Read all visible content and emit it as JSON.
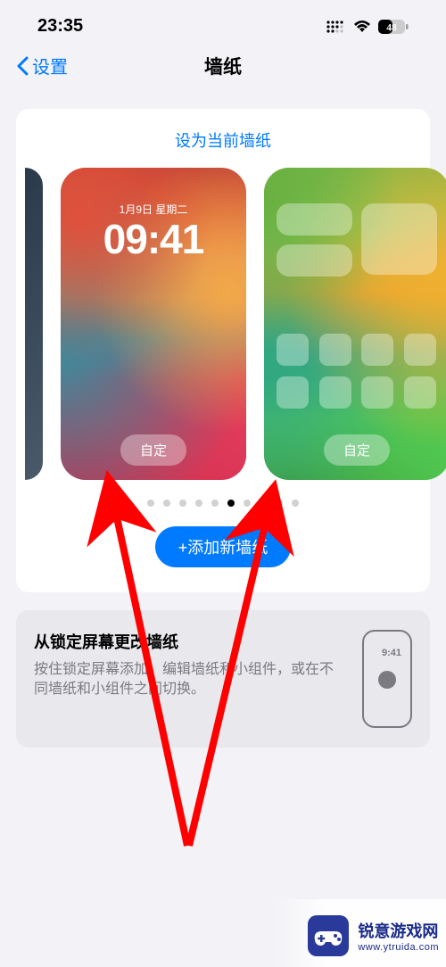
{
  "statusbar": {
    "time": "23:35",
    "battery": "48"
  },
  "nav": {
    "back_label": "设置",
    "title": "墙纸"
  },
  "card": {
    "set_current_label": "设为当前墙纸",
    "lock_date": "1月9日 星期二",
    "lock_time": "09:41",
    "customize_label": "自定",
    "add_new_label": "+添加新墙纸",
    "dot_count": 10,
    "active_dot_index": 5
  },
  "help": {
    "title": "从锁定屏幕更改墙纸",
    "description": "按住锁定屏幕添加、编辑墙纸和小组件，或在不同墙纸和小组件之间切换。",
    "phone_time": "9:41"
  },
  "watermark": {
    "name": "锐意游戏网",
    "url": "www.ytruida.com"
  },
  "colors": {
    "accent": "#007aff",
    "arrow": "#ff0000"
  }
}
